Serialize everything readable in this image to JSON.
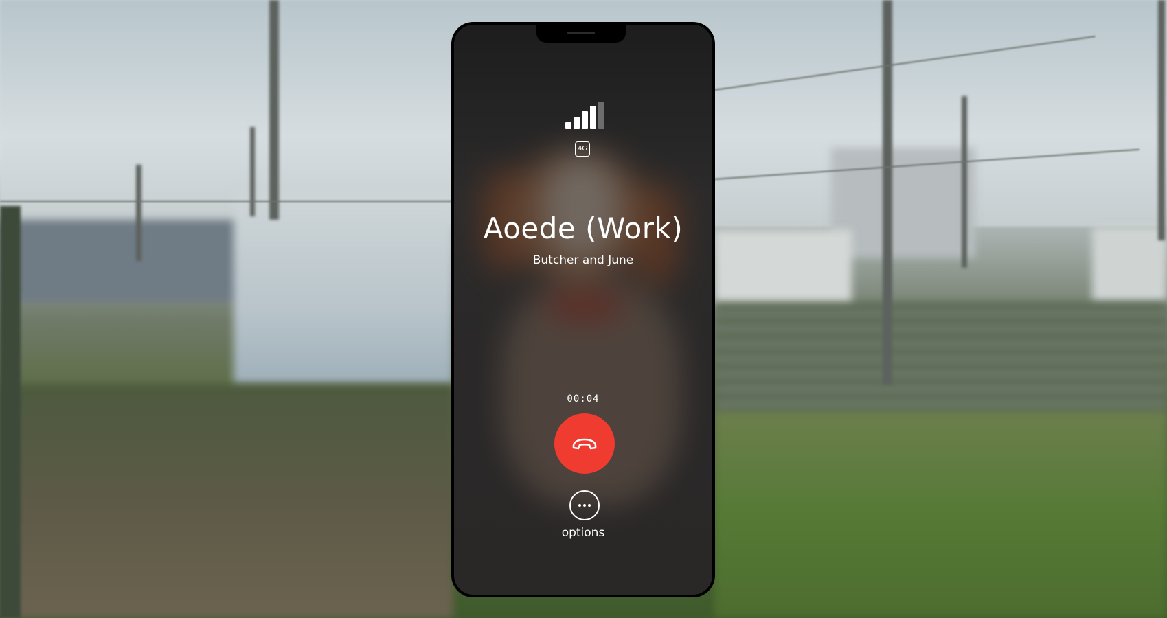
{
  "call": {
    "caller_name": "Aoede (Work)",
    "caller_subtitle": "Butcher and June",
    "duration": "00:04",
    "network_type": "4G",
    "signal_bars_active": 4,
    "signal_bars_total": 5
  },
  "controls": {
    "end_call_icon": "phone-hangup-icon",
    "options_icon": "more-horizontal-icon",
    "options_label": "options"
  },
  "colors": {
    "end_call": "#f03b30",
    "screen_bg": "#2a2828",
    "text": "#ffffff"
  }
}
